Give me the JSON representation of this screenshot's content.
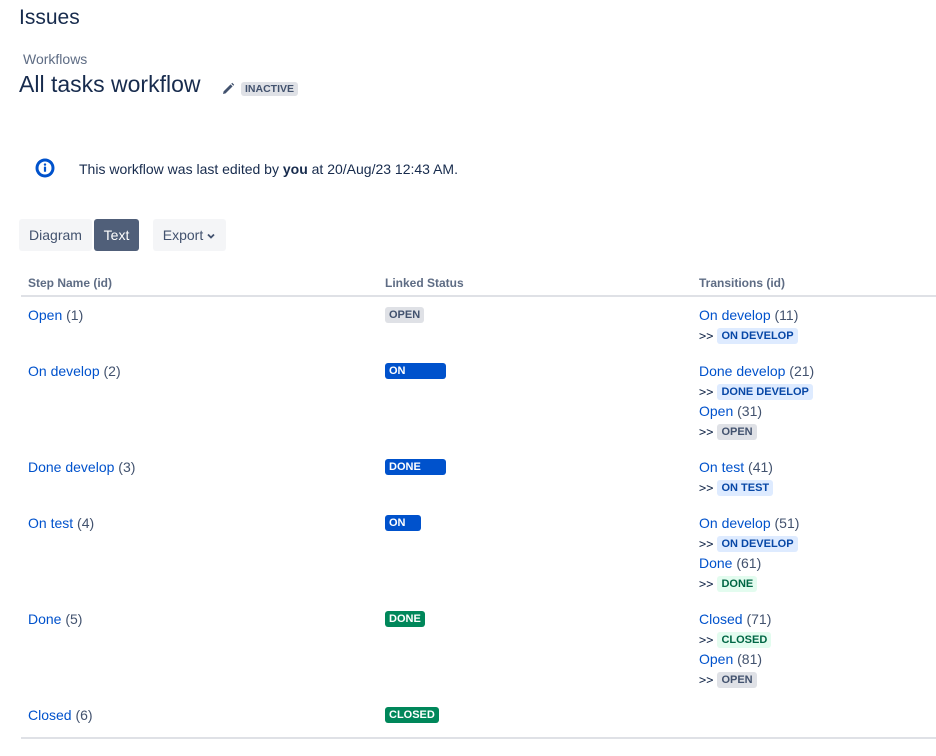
{
  "page_heading": "Issues",
  "breadcrumb": "Workflows",
  "workflow_title": "All tasks workflow",
  "inactive_badge": "INACTIVE",
  "info": {
    "prefix": "This workflow was last edited by",
    "user": "you",
    "suffix": "at 20/Aug/23 12:43 AM."
  },
  "view_buttons": {
    "diagram": "Diagram",
    "text": "Text",
    "export": "Export"
  },
  "columns": {
    "step": "Step Name (id)",
    "status": "Linked Status",
    "transitions": "Transitions (id)"
  },
  "colors": {
    "link": "#0052cc",
    "blue_bold": "#0052cc",
    "green_bold": "#00875a",
    "gray_sub": "#dfe1e6",
    "blue_sub": "#deebff",
    "green_sub": "#e3fcef"
  },
  "arrow": ">>",
  "rows": [
    {
      "step": "Open",
      "id": "(1)",
      "status": "OPEN",
      "status_style": "gray-sub",
      "transitions": [
        {
          "name": "On develop",
          "id": "(11)",
          "target": "ON DEVELOP",
          "target_style": "blue-sub"
        }
      ]
    },
    {
      "step": "On develop",
      "id": "(2)",
      "status": "ON DEVELOP",
      "status_style": "blue-bold",
      "transitions": [
        {
          "name": "Done develop",
          "id": "(21)",
          "target": "DONE DEVELOP",
          "target_style": "blue-sub"
        },
        {
          "name": "Open",
          "id": "(31)",
          "target": "OPEN",
          "target_style": "gray-sub"
        }
      ]
    },
    {
      "step": "Done develop",
      "id": "(3)",
      "status": "DONE DEVELOP",
      "status_style": "blue-bold",
      "transitions": [
        {
          "name": "On test",
          "id": "(41)",
          "target": "ON TEST",
          "target_style": "blue-sub"
        }
      ]
    },
    {
      "step": "On test",
      "id": "(4)",
      "status": "ON TEST",
      "status_style": "blue-bold",
      "transitions": [
        {
          "name": "On develop",
          "id": "(51)",
          "target": "ON DEVELOP",
          "target_style": "blue-sub"
        },
        {
          "name": "Done",
          "id": "(61)",
          "target": "DONE",
          "target_style": "green-sub"
        }
      ]
    },
    {
      "step": "Done",
      "id": "(5)",
      "status": "DONE",
      "status_style": "green-bold",
      "transitions": [
        {
          "name": "Closed",
          "id": "(71)",
          "target": "CLOSED",
          "target_style": "green-sub"
        },
        {
          "name": "Open",
          "id": "(81)",
          "target": "OPEN",
          "target_style": "gray-sub"
        }
      ]
    },
    {
      "step": "Closed",
      "id": "(6)",
      "status": "CLOSED",
      "status_style": "green-bold",
      "transitions": []
    }
  ]
}
